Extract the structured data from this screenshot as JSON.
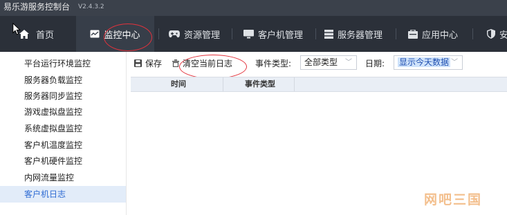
{
  "titlebar": {
    "app_name": "易乐游服务控制台",
    "version": "V2.4.3.2"
  },
  "nav": {
    "items": [
      {
        "label": "首页",
        "icon": "home-icon"
      },
      {
        "label": "监控中心",
        "icon": "monitor-chart-icon",
        "active": true
      },
      {
        "label": "资源管理",
        "icon": "gamepad-icon"
      },
      {
        "label": "客户机管理",
        "icon": "desktop-icon"
      },
      {
        "label": "服务器管理",
        "icon": "server-icon"
      },
      {
        "label": "应用中心",
        "icon": "app-box-icon"
      },
      {
        "label": "安",
        "icon": "shield-icon"
      }
    ]
  },
  "sidebar": {
    "items": [
      {
        "label": "平台运行环境监控"
      },
      {
        "label": "服务器负载监控"
      },
      {
        "label": "服务器同步监控"
      },
      {
        "label": "游戏虚拟盘监控"
      },
      {
        "label": "系统虚拟盘监控"
      },
      {
        "label": "客户机温度监控"
      },
      {
        "label": "客户机硬件监控"
      },
      {
        "label": "内网流量监控"
      },
      {
        "label": "客户机日志",
        "active": true
      }
    ]
  },
  "toolbar": {
    "save_label": "保存",
    "clear_label": "清空当前日志",
    "event_type_label": "事件类型:",
    "event_type_value": "全部类型",
    "date_label": "日期:",
    "date_value": "显示今天数据"
  },
  "table": {
    "columns": [
      "时间",
      "事件类型"
    ]
  },
  "watermark": "网吧三国",
  "colors": {
    "accent": "#2e6bd3",
    "nav_bg": "#2b3039",
    "highlight_circle": "#e3323c"
  }
}
